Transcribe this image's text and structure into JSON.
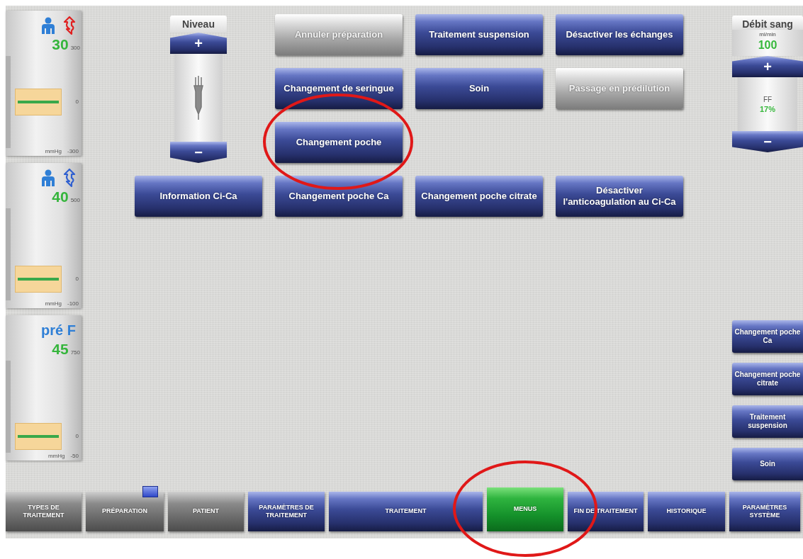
{
  "gauges": [
    {
      "kind": "arterial",
      "value": "30",
      "max": "300",
      "zero": "0",
      "unit": "mmHg",
      "min": "-300"
    },
    {
      "kind": "venous",
      "value": "40",
      "max": "500",
      "zero": "0",
      "unit": "mmHg",
      "min": "-100"
    },
    {
      "kind": "prefilter",
      "label": "pré F",
      "value": "45",
      "max": "750",
      "zero": "0",
      "unit": "mmHg",
      "min": "-50"
    }
  ],
  "level_control": {
    "title": "Niveau",
    "plus": "+",
    "minus": "−"
  },
  "menu_buttons": [
    {
      "label": "Annuler préparation",
      "disabled": true
    },
    {
      "label": "Traitement suspension",
      "disabled": false
    },
    {
      "label": "Désactiver les échanges",
      "disabled": false
    },
    {
      "label": "Changement de seringue",
      "disabled": false
    },
    {
      "label": "Soin",
      "disabled": false
    },
    {
      "label": "Passage en prédilution",
      "disabled": true
    },
    {
      "label": "Changement poche",
      "disabled": false
    }
  ],
  "ci_ca_buttons": [
    {
      "label": "Information Ci-Ca",
      "disabled": false
    },
    {
      "label": "Changement poche Ca",
      "disabled": false
    },
    {
      "label": "Changement poche citrate",
      "disabled": false
    },
    {
      "label": "Désactiver l'anticoagulation au Ci-Ca",
      "disabled": false
    }
  ],
  "blood_flow": {
    "title": "Débit sang",
    "unit": "ml/min",
    "value": "100",
    "plus": "+",
    "ff_label": "FF",
    "ff_value": "17%",
    "minus": "−"
  },
  "shortcut_buttons": [
    {
      "label": "Changement poche Ca"
    },
    {
      "label": "Changement poche citrate"
    },
    {
      "label": "Traitement suspension"
    },
    {
      "label": "Soin"
    }
  ],
  "tabs": [
    {
      "label": "TYPES DE TRAITEMENT",
      "disabled": true,
      "selected": false,
      "flag": false
    },
    {
      "label": "PRÉPARATION",
      "disabled": true,
      "selected": false,
      "flag": true
    },
    {
      "label": "PATIENT",
      "disabled": true,
      "selected": false,
      "flag": false
    },
    {
      "label": "PARAMÈTRES DE TRAITEMENT",
      "disabled": false,
      "selected": false,
      "flag": false
    },
    {
      "label": "TRAITEMENT",
      "disabled": false,
      "selected": false,
      "flag": false
    },
    {
      "label": "MENUS",
      "disabled": false,
      "selected": true,
      "flag": false
    },
    {
      "label": "FIN DE TRAITEMENT",
      "disabled": false,
      "selected": false,
      "flag": false
    },
    {
      "label": "HISTORIQUE",
      "disabled": false,
      "selected": false,
      "flag": false
    },
    {
      "label": "PARAMÈTRES SYSTÈME",
      "disabled": false,
      "selected": false,
      "flag": false
    }
  ]
}
